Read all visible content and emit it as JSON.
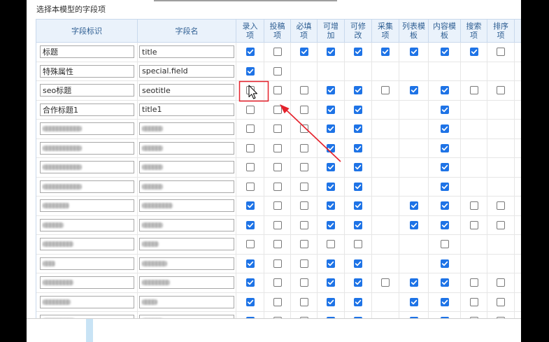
{
  "panel": {
    "title": "选择本模型的字段项"
  },
  "table": {
    "headers": [
      {
        "lines": [
          "字段标识"
        ]
      },
      {
        "lines": [
          "字段名"
        ]
      },
      {
        "lines": [
          "录入",
          "项"
        ]
      },
      {
        "lines": [
          "投稿",
          "项"
        ]
      },
      {
        "lines": [
          "必填",
          "项"
        ]
      },
      {
        "lines": [
          "可增",
          "加"
        ]
      },
      {
        "lines": [
          "可修",
          "改"
        ]
      },
      {
        "lines": [
          "采集",
          "项"
        ]
      },
      {
        "lines": [
          "列表模",
          "板"
        ]
      },
      {
        "lines": [
          "内容模",
          "板"
        ]
      },
      {
        "lines": [
          "搜索",
          "项"
        ]
      },
      {
        "lines": [
          "排序",
          "项"
        ]
      }
    ],
    "rows": [
      {
        "label": "标题",
        "field": "title",
        "flags": [
          true,
          false,
          true,
          true,
          true,
          true,
          true,
          true,
          true,
          false
        ]
      },
      {
        "label": "特殊属性",
        "field": "special.field",
        "flags": [
          true,
          false,
          null,
          null,
          null,
          null,
          null,
          null,
          null,
          null
        ]
      },
      {
        "label": "seo标题",
        "field": "seotitle",
        "flags": [
          false,
          false,
          false,
          true,
          true,
          false,
          true,
          true,
          false,
          false
        ]
      },
      {
        "label": "合作标题1",
        "field": "title1",
        "flags": [
          false,
          false,
          false,
          true,
          true,
          null,
          null,
          true,
          null,
          null
        ]
      },
      {
        "obscured": true,
        "flags": [
          false,
          false,
          false,
          true,
          true,
          null,
          null,
          true,
          null,
          null
        ]
      },
      {
        "obscured": true,
        "flags": [
          false,
          false,
          false,
          true,
          true,
          null,
          null,
          true,
          null,
          null
        ]
      },
      {
        "obscured": true,
        "flags": [
          false,
          false,
          false,
          true,
          true,
          null,
          null,
          true,
          null,
          null
        ]
      },
      {
        "obscured": true,
        "flags": [
          false,
          false,
          false,
          true,
          true,
          null,
          null,
          true,
          null,
          null
        ]
      },
      {
        "obscured": true,
        "flags": [
          true,
          false,
          false,
          true,
          true,
          null,
          true,
          true,
          false,
          false
        ]
      },
      {
        "obscured": true,
        "flags": [
          true,
          false,
          false,
          true,
          true,
          null,
          true,
          true,
          false,
          false
        ]
      },
      {
        "obscured": true,
        "flags": [
          false,
          false,
          false,
          false,
          false,
          null,
          null,
          false,
          null,
          null
        ]
      },
      {
        "obscured": true,
        "flags": [
          true,
          false,
          false,
          true,
          true,
          null,
          null,
          true,
          null,
          null
        ]
      },
      {
        "obscured": true,
        "flags": [
          true,
          false,
          false,
          true,
          true,
          false,
          true,
          true,
          false,
          false
        ]
      },
      {
        "obscured": true,
        "flags": [
          true,
          false,
          false,
          true,
          true,
          null,
          true,
          true,
          false,
          false
        ]
      },
      {
        "obscured": true,
        "flags": [
          true,
          false,
          false,
          true,
          true,
          null,
          true,
          true,
          false,
          false
        ]
      }
    ]
  },
  "colors": {
    "checkbox_checked": "#1e73e6",
    "annotation_red": "#e5212b",
    "header_bg": "#eaf2fb",
    "header_text": "#2f5f93",
    "accent_strip": "#c8e3f5"
  }
}
